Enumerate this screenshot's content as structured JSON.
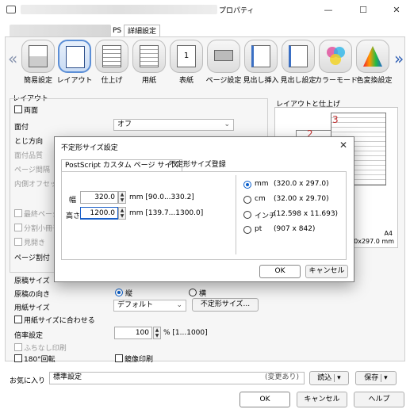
{
  "window": {
    "title": "プロパティ",
    "icons": {
      "app": "printer-icon",
      "minimize": "minimize-icon",
      "maximize": "maximize-icon",
      "close": "close-icon"
    }
  },
  "tabs": [
    {
      "label": "PS"
    },
    {
      "label": "詳細設定"
    }
  ],
  "toolbar": {
    "items": [
      {
        "label": "簡易設定",
        "icon": "quick-settings-icon"
      },
      {
        "label": "レイアウト",
        "icon": "layout-icon"
      },
      {
        "label": "仕上げ",
        "icon": "finishing-icon"
      },
      {
        "label": "用紙",
        "icon": "paper-icon"
      },
      {
        "label": "表紙",
        "icon": "cover-icon"
      },
      {
        "label": "ページ設定",
        "icon": "page-setup-icon"
      },
      {
        "label": "見出し挿入",
        "icon": "tab-insert-icon"
      },
      {
        "label": "見出し設定",
        "icon": "tab-setting-icon"
      },
      {
        "label": "カラーモード",
        "icon": "color-mode-icon"
      },
      {
        "label": "色変換設定",
        "icon": "color-conversion-icon"
      }
    ],
    "left_arrow": "«",
    "right_arrow": "»"
  },
  "layout": {
    "group_title": "レイアウト",
    "duplex": "両面",
    "binding_label": "面付",
    "binding_value": "オフ",
    "opening_label": "とじ方向",
    "face_label": "面付品質",
    "page_spacing_label": "ページ間隔",
    "inner_offset_label": "内側オフセット",
    "last_page": "最終ページ",
    "split_booklet": "分割小冊子",
    "spread": "見開き",
    "page_assign": "ページ割付"
  },
  "paper": {
    "original_size_label": "原稿サイズ",
    "orientation_label": "原稿の向き",
    "orientation_portrait": "縦",
    "orientation_landscape": "横",
    "paper_size_label": "用紙サイズ",
    "paper_size_value": "デフォルト",
    "custom_size_button": "不定形サイズ...",
    "fit_to_paper": "用紙サイズに合わせる",
    "zoom_label": "倍率設定",
    "zoom_value": "100",
    "zoom_range": "% [1...1000]",
    "borderless": "ふちなし印刷",
    "rotate180": "180°回転",
    "mirror": "鏡像印刷"
  },
  "preview": {
    "title": "レイアウトと仕上げ",
    "paper_name": "A4",
    "paper_size": "0.0x297.0 mm",
    "page_numbers": [
      "3",
      "2"
    ]
  },
  "favorites": {
    "label": "お気に入り",
    "value": "標準設定",
    "status": "(変更あり)",
    "load_button": "読込",
    "save_button": "保存",
    "dropdown": "▾"
  },
  "footer": {
    "ok": "OK",
    "cancel": "キャンセル",
    "help": "ヘルプ"
  },
  "dialog": {
    "title": "不定形サイズ設定",
    "tabs": [
      "PostScript カスタム ページ サイズ",
      "不定形サイズ登録"
    ],
    "width_label": "幅",
    "width_value": "320.0",
    "width_range": "mm [90.0...330.2]",
    "height_label": "高さ",
    "height_value": "1200.0",
    "height_range": "mm [139.7...1300.0]",
    "units": [
      {
        "label": "mm",
        "value": "(320.0 x 297.0)",
        "selected": true
      },
      {
        "label": "cm",
        "value": "(32.00 x 29.70)",
        "selected": false
      },
      {
        "label": "インチ",
        "value": "(12.598 x 11.693)",
        "selected": false
      },
      {
        "label": "pt",
        "value": "(907 x 842)",
        "selected": false
      }
    ],
    "ok": "OK",
    "cancel": "キャンセル"
  },
  "colors": {
    "accent": "#0a5fcc",
    "selection": "#5b8ed6"
  }
}
